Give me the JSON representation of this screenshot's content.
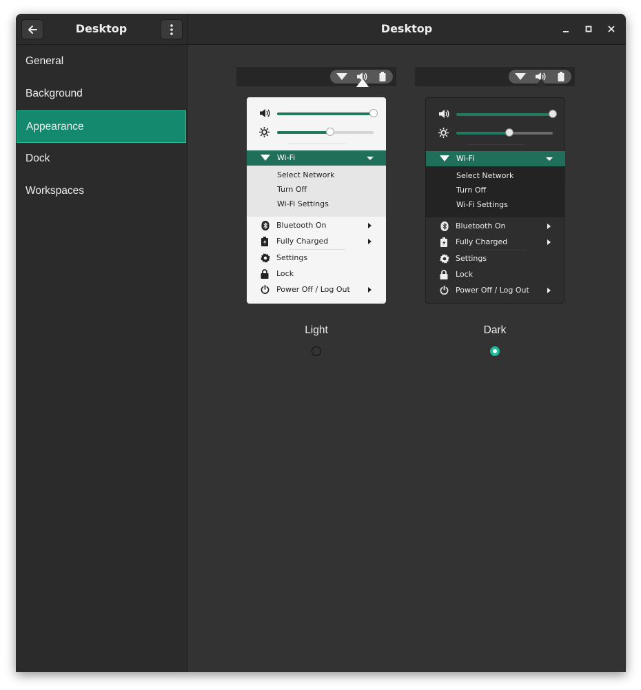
{
  "header": {
    "left_title": "Desktop",
    "right_title": "Desktop",
    "icons": {
      "back": "arrow-left-icon",
      "menu": "vertical-dots-icon",
      "minimize": "minimize-icon",
      "maximize": "maximize-icon",
      "close": "close-icon"
    }
  },
  "sidebar": {
    "items": [
      {
        "label": "General",
        "selected": false
      },
      {
        "label": "Background",
        "selected": false
      },
      {
        "label": "Appearance",
        "selected": true
      },
      {
        "label": "Dock",
        "selected": false
      },
      {
        "label": "Workspaces",
        "selected": false
      }
    ]
  },
  "colors": {
    "accent": "#15896e",
    "radio_selected": "#1abc9c",
    "window_bg": "#333333",
    "sidebar_bg": "#2b2b2b"
  },
  "themes": [
    {
      "name": "Light",
      "selected": false,
      "menu": {
        "volume_level": 1.0,
        "brightness_level": 0.55,
        "wifi_label": "Wi-Fi",
        "wifi_items": [
          "Select Network",
          "Turn Off",
          "Wi-Fi Settings"
        ],
        "items": [
          {
            "icon": "bluetooth-icon",
            "label": "Bluetooth On",
            "submenu": true
          },
          {
            "icon": "battery-charging-icon",
            "label": "Fully Charged",
            "submenu": true
          },
          {
            "icon": "gear-icon",
            "label": "Settings",
            "submenu": false
          },
          {
            "icon": "lock-icon",
            "label": "Lock",
            "submenu": false
          },
          {
            "icon": "power-icon",
            "label": "Power Off / Log Out",
            "submenu": true
          }
        ]
      }
    },
    {
      "name": "Dark",
      "selected": true,
      "menu": {
        "volume_level": 1.0,
        "brightness_level": 0.55,
        "wifi_label": "Wi-Fi",
        "wifi_items": [
          "Select Network",
          "Turn Off",
          "Wi-Fi Settings"
        ],
        "items": [
          {
            "icon": "bluetooth-icon",
            "label": "Bluetooth On",
            "submenu": true
          },
          {
            "icon": "battery-charging-icon",
            "label": "Fully Charged",
            "submenu": true
          },
          {
            "icon": "gear-icon",
            "label": "Settings",
            "submenu": false
          },
          {
            "icon": "lock-icon",
            "label": "Lock",
            "submenu": false
          },
          {
            "icon": "power-icon",
            "label": "Power Off / Log Out",
            "submenu": true
          }
        ]
      }
    }
  ]
}
